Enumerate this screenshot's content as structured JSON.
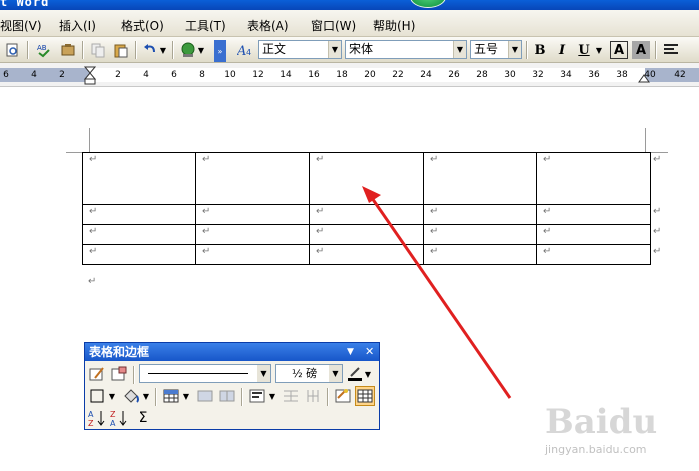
{
  "window": {
    "title": "t Word"
  },
  "menu": [
    "视图(V)",
    "插入(I)",
    "格式(O)",
    "工具(T)",
    "表格(A)",
    "窗口(W)",
    "帮助(H)"
  ],
  "toolbar": {
    "style": "正文",
    "font": "宋体",
    "size": "五号",
    "bold": "B",
    "italic": "I",
    "underline": "U",
    "char_border": "A",
    "char_shading": "A",
    "style_icon": "A"
  },
  "ruler": {
    "ticks": [
      "6",
      "4",
      "2",
      "2",
      "4",
      "6",
      "8",
      "10",
      "12",
      "14",
      "16",
      "18",
      "20",
      "22",
      "24",
      "26",
      "28",
      "30",
      "32",
      "34",
      "36",
      "38",
      "40",
      "42"
    ]
  },
  "document": {
    "paragraph_mark": "↵",
    "rows": 4,
    "cols": 5
  },
  "table_toolbar": {
    "title": "表格和边框",
    "line_weight": "½ 磅",
    "sigma": "Σ",
    "sort_asc": "A↓Z",
    "sort_desc": "Z↓A"
  },
  "watermark": {
    "logo": "Baidu",
    "url": "jingyan.baidu.com"
  },
  "colors": {
    "titlebar": "#0a5fd8",
    "arrow": "#e02020",
    "toolbar_head": "#2a6ad8"
  }
}
